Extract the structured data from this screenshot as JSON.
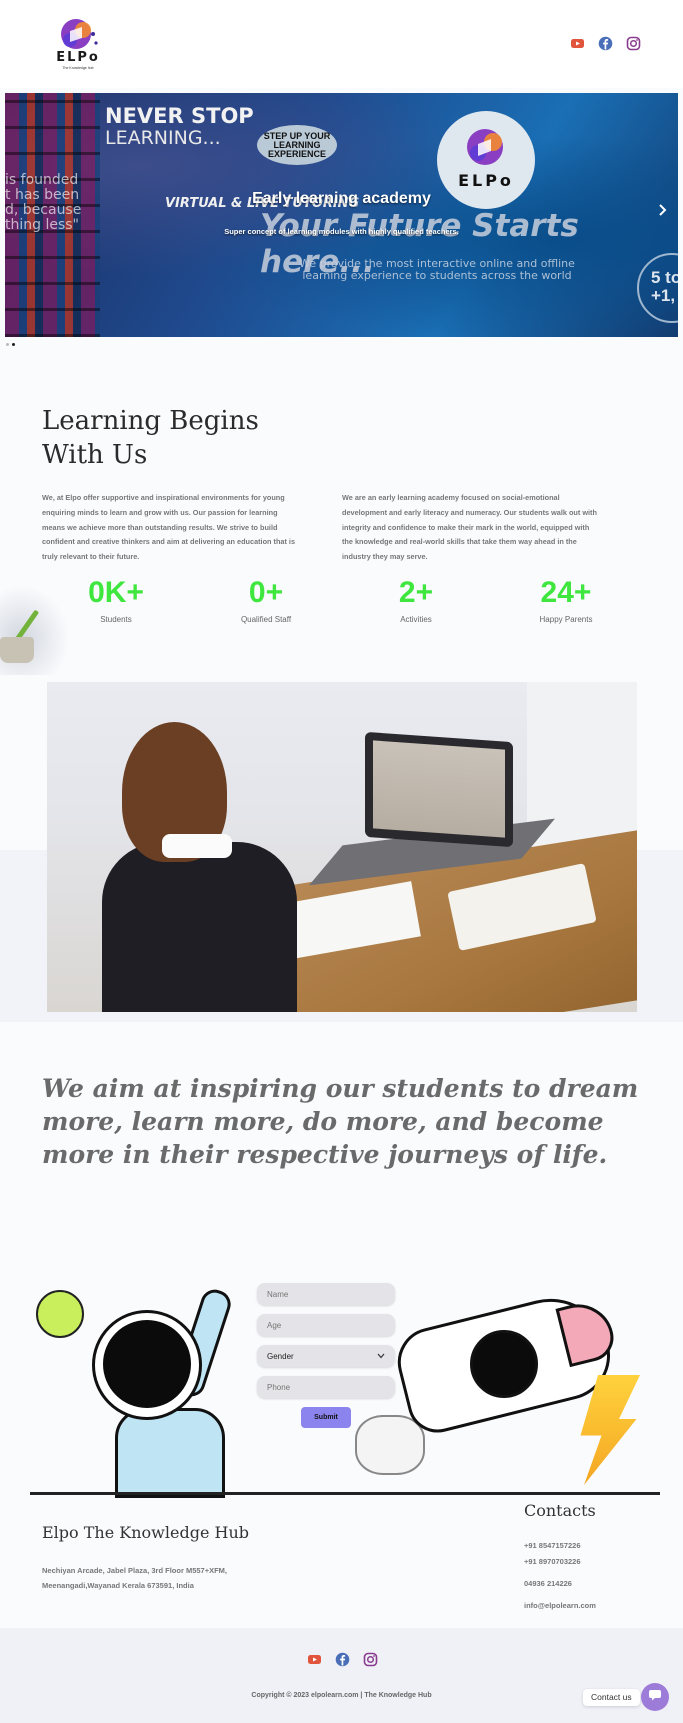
{
  "header": {
    "logo_text": "ELPo",
    "logo_tagline": "The Knowledge hub"
  },
  "social_icons": [
    "youtube-icon",
    "facebook-icon",
    "instagram-icon"
  ],
  "hero": {
    "slide_title": "Early learning academy",
    "slide_subtitle": "Super concept of learning modules with highly qualified teachers.",
    "bg_text": {
      "never_stop": "NEVER STOP",
      "learning": "LEARNING...",
      "quote": "is founded t has been d, because thing less\"",
      "step_up": "STEP UP YOUR LEARNING EXPERIENCE",
      "virtual": "VIRTUAL & LIVE TUTORING",
      "future": "Your Future Starts here...",
      "provide": "We provide the most interactive online and offline learning experience to students across the world",
      "five": "5 to +1,"
    },
    "next_icon": "chevron-right-icon",
    "dots": 2
  },
  "learning": {
    "heading_line1": "Learning Begins",
    "heading_line2": "With Us",
    "para_left": "We, at Elpo offer supportive and inspirational environments for young enquiring minds to learn and grow with us. Our passion for learning means we achieve more than outstanding results. We strive to build confident and creative thinkers and aim at delivering an education that is truly relevant to their future.",
    "para_right": "We are an early learning academy focused on social-emotional development and early literacy and numeracy. Our students walk out with integrity and confidence to make their mark in the world, equipped with the knowledge and real-world skills that take them way ahead in the industry they may serve.",
    "stats": [
      {
        "value": "0K+",
        "label": "Students"
      },
      {
        "value": "0+",
        "label": "Qualified Staff"
      },
      {
        "value": "2+",
        "label": "Activities"
      },
      {
        "value": "24+",
        "label": "Happy Parents"
      }
    ],
    "stat_color": "#3ee63e"
  },
  "quote": "We aim at inspiring our students to dream more, learn more, do more, and become more in their respective journeys of life.",
  "form": {
    "name_placeholder": "Name",
    "age_placeholder": "Age",
    "gender_value": "Gender",
    "phone_placeholder": "Phone",
    "submit_label": "Submit",
    "submit_color": "#8b83ee"
  },
  "footer": {
    "title": "Elpo The Knowledge Hub",
    "address_line1": "Nechiyan Arcade, Jabel Plaza, 3rd Floor M557+XFM,",
    "address_line2": "Meenangadi,Wayanad Kerala 673591, India",
    "contacts_title": "Contacts",
    "phone1": "+91 8547157226",
    "phone2": "+91 8970703226",
    "landline": "04936 214226",
    "email": "info@elpolearn.com",
    "copyright": "Copyright © 2023 elpolearn.com | The Knowledge Hub",
    "contact_us": "Contact us"
  }
}
